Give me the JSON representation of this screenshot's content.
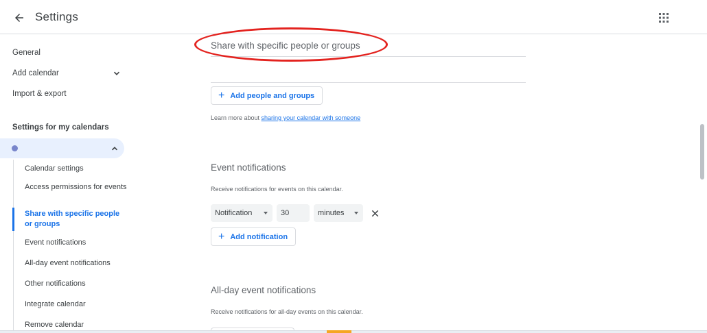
{
  "header": {
    "title": "Settings",
    "back_icon": "arrow-back-icon",
    "apps_icon": "apps-grid-icon"
  },
  "sidebar": {
    "general": "General",
    "add_calendar": "Add calendar",
    "import_export": "Import & export",
    "section_heading": "Settings for my calendars",
    "calendar_color": "#7986cb",
    "calendar_name": "",
    "sub_items": [
      "Calendar settings",
      "Access permissions for events",
      "Share with specific people or groups",
      "Event notifications",
      "All-day event notifications",
      "Other notifications",
      "Integrate calendar",
      "Remove calendar"
    ],
    "active_sub_item": "Share with specific people or groups"
  },
  "share": {
    "title": "Share with specific people or groups",
    "add_people_label": "Add people and groups",
    "learn_prefix": "Learn more about ",
    "learn_link": "sharing your calendar with someone"
  },
  "event_notifications": {
    "title": "Event notifications",
    "description": "Receive notifications for events on this calendar.",
    "type_value": "Notification",
    "amount_value": "30",
    "unit_value": "minutes",
    "add_label": "Add notification"
  },
  "allday_notifications": {
    "title": "All-day event notifications",
    "description": "Receive notifications for all-day events on this calendar."
  },
  "colors": {
    "accent": "#1a73e8",
    "highlight": "#e3231f",
    "active_bg": "#e8f0fe"
  }
}
